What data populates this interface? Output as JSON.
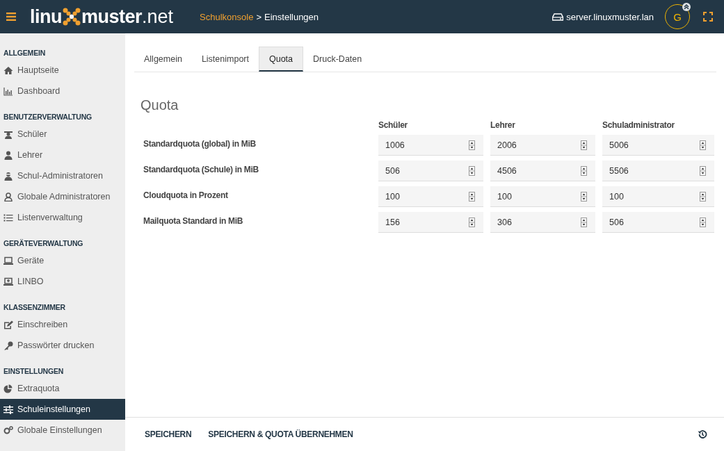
{
  "header": {
    "logo": {
      "left": "linu",
      "right": "muster",
      "suffix": ".net"
    },
    "breadcrumb": {
      "parent": "Schulkonsole",
      "separator": ">",
      "current": "Einstellungen"
    },
    "server": "server.linuxmuster.lan",
    "avatar": "G"
  },
  "sidebar": {
    "sections": [
      {
        "title": "ALLGEMEIN",
        "items": [
          {
            "label": "Hauptseite",
            "kind": "home",
            "selected": false
          },
          {
            "label": "Dashboard",
            "kind": "chart",
            "selected": false
          }
        ]
      },
      {
        "title": "BENUTZERVERWALTUNG",
        "items": [
          {
            "label": "Schüler",
            "kind": "student",
            "selected": false
          },
          {
            "label": "Lehrer",
            "kind": "teacher",
            "selected": false
          },
          {
            "label": "Schul-Administratoren",
            "kind": "admin",
            "selected": false
          },
          {
            "label": "Globale Administratoren",
            "kind": "globaladmin",
            "selected": false
          },
          {
            "label": "Listenverwaltung",
            "kind": "list",
            "selected": false
          }
        ]
      },
      {
        "title": "GERÄTEVERWALTUNG",
        "items": [
          {
            "label": "Geräte",
            "kind": "laptop",
            "selected": false
          },
          {
            "label": "LINBO",
            "kind": "linbo",
            "selected": false
          }
        ]
      },
      {
        "title": "KLASSENZIMMER",
        "items": [
          {
            "label": "Einschreiben",
            "kind": "edit",
            "selected": false
          },
          {
            "label": "Passwörter drucken",
            "kind": "key",
            "selected": false
          }
        ]
      },
      {
        "title": "EINSTELLUNGEN",
        "items": [
          {
            "label": "Extraquota",
            "kind": "pie",
            "selected": false
          },
          {
            "label": "Schuleinstellungen",
            "kind": "sliders",
            "selected": true
          },
          {
            "label": "Globale Einstellungen",
            "kind": "gears",
            "selected": false
          }
        ]
      }
    ]
  },
  "tabs": [
    {
      "label": "Allgemein",
      "selected": false
    },
    {
      "label": "Listenimport",
      "selected": false
    },
    {
      "label": "Quota",
      "selected": true
    },
    {
      "label": "Druck-Daten",
      "selected": false
    }
  ],
  "quota": {
    "title": "Quota",
    "columns": [
      "Schüler",
      "Lehrer",
      "Schuladministrator"
    ],
    "rows": [
      {
        "label": "Standardquota (global) in MiB",
        "values": [
          "1006",
          "2006",
          "5006"
        ]
      },
      {
        "label": "Standardquota (Schule) in MiB",
        "values": [
          "506",
          "4506",
          "5506"
        ]
      },
      {
        "label": "Cloudquota in Prozent",
        "values": [
          "100",
          "100",
          "100"
        ]
      },
      {
        "label": "Mailquota Standard in MiB",
        "values": [
          "156",
          "306",
          "506"
        ]
      }
    ]
  },
  "footer": {
    "buttons": [
      "SPEICHERN",
      "SPEICHERN & QUOTA ÜBERNEHMEN"
    ]
  }
}
